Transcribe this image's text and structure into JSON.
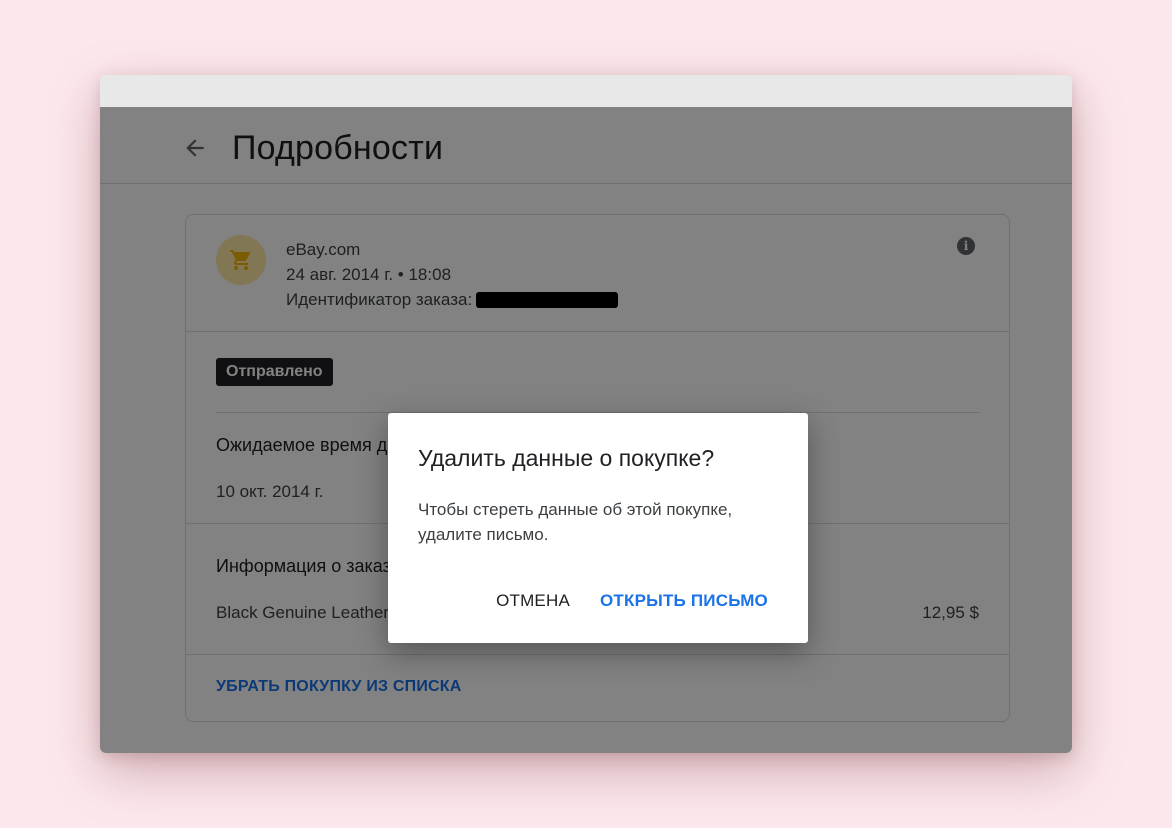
{
  "header": {
    "title": "Подробности"
  },
  "purchase": {
    "merchant": "eBay.com",
    "datetime": "24 авг. 2014 г. • 18:08",
    "order_id_label": "Идентификатор заказа:",
    "status": "Отправлено",
    "delivery_heading": "Ожидаемое время доставки",
    "delivery_date": "10 окт. 2014 г.",
    "order_info_heading": "Информация о заказе",
    "item_name": "Black Genuine Leather",
    "item_price": "12,95 $",
    "remove_label": "УБРАТЬ ПОКУПКУ ИЗ СПИСКА"
  },
  "dialog": {
    "title": "Удалить данные о покупке?",
    "body": "Чтобы стереть данные об этой покупке, удалите письмо.",
    "cancel_label": "ОТМЕНА",
    "confirm_label": "ОТКРЫТЬ ПИСЬМО"
  },
  "icons": {
    "back": "arrow-back-icon",
    "merchant": "shopping-cart-icon",
    "info": "info-icon"
  },
  "colors": {
    "accent": "#1a73e8",
    "avatar_bg": "#fde9a6",
    "cart": "#f4b400",
    "background": "#fce8ec"
  }
}
